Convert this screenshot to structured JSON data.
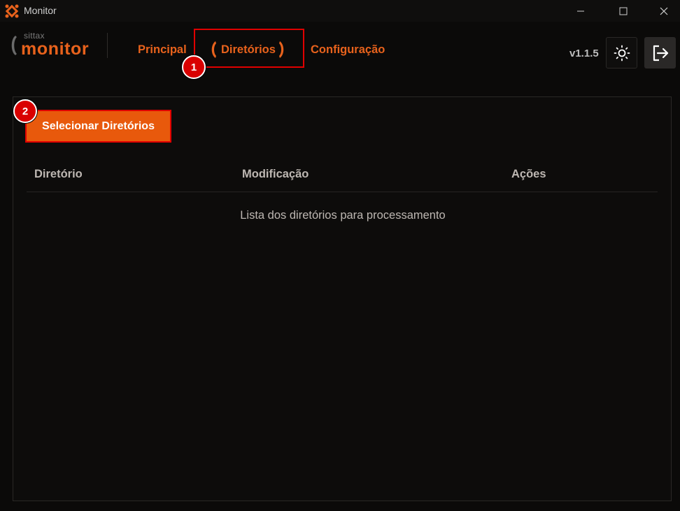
{
  "window": {
    "title": "Monitor",
    "icons": [
      "app-logo-icon",
      "minimize-icon",
      "maximize-icon",
      "close-icon"
    ]
  },
  "brand": {
    "small": "sittax",
    "name": "monitor"
  },
  "nav": {
    "items": [
      {
        "label": "Principal"
      },
      {
        "label": "Diretórios",
        "active": true
      },
      {
        "label": "Configuração"
      }
    ]
  },
  "header": {
    "version": "v1.1.5",
    "theme_icon": "sun-icon",
    "logout_icon": "logout-icon"
  },
  "annotations": {
    "badge_1": "1",
    "badge_2": "2"
  },
  "directories": {
    "select_button": "Selecionar Diretórios",
    "columns": [
      "Diretório",
      "Modificação",
      "Ações"
    ],
    "empty_message": "Lista dos diretórios para processamento"
  },
  "colors": {
    "accent": "#e8621c",
    "button": "#e8590c",
    "highlight": "#e00000",
    "background": "#0b0a09"
  }
}
